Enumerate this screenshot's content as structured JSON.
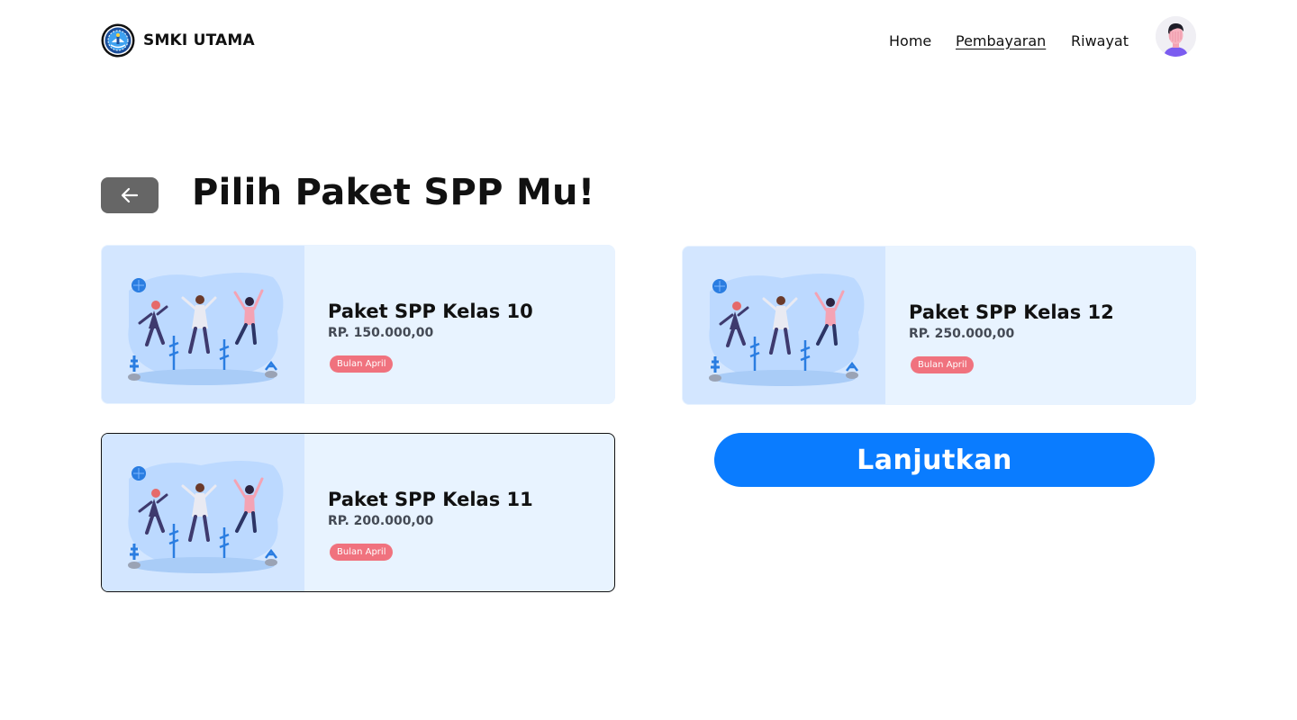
{
  "header": {
    "brand_name": "SMKI UTAMA",
    "nav": [
      {
        "label": "Home",
        "active": false
      },
      {
        "label": "Pembayaran",
        "active": true
      },
      {
        "label": "Riwayat",
        "active": false
      }
    ]
  },
  "main": {
    "title": "Pilih Paket SPP Mu!",
    "packages": [
      {
        "name": "Paket SPP Kelas 10",
        "price": "RP. 150.000,00",
        "badge": "Bulan April",
        "selected": false
      },
      {
        "name": "Paket SPP Kelas 11",
        "price": "RP. 200.000,00",
        "badge": "Bulan April",
        "selected": true
      },
      {
        "name": "Paket SPP Kelas 12",
        "price": "RP. 250.000,00",
        "badge": "Bulan April",
        "selected": false
      }
    ],
    "continue_label": "Lanjutkan"
  },
  "icons": {
    "back": "arrow-left-icon",
    "logo": "school-emblem-icon",
    "avatar": "user-avatar-icon"
  },
  "colors": {
    "primary": "#0a7cff",
    "card_bg": "#e8f3ff",
    "art_bg": "#d3e6ff",
    "badge": "#f0727e",
    "back_button": "#666666"
  }
}
